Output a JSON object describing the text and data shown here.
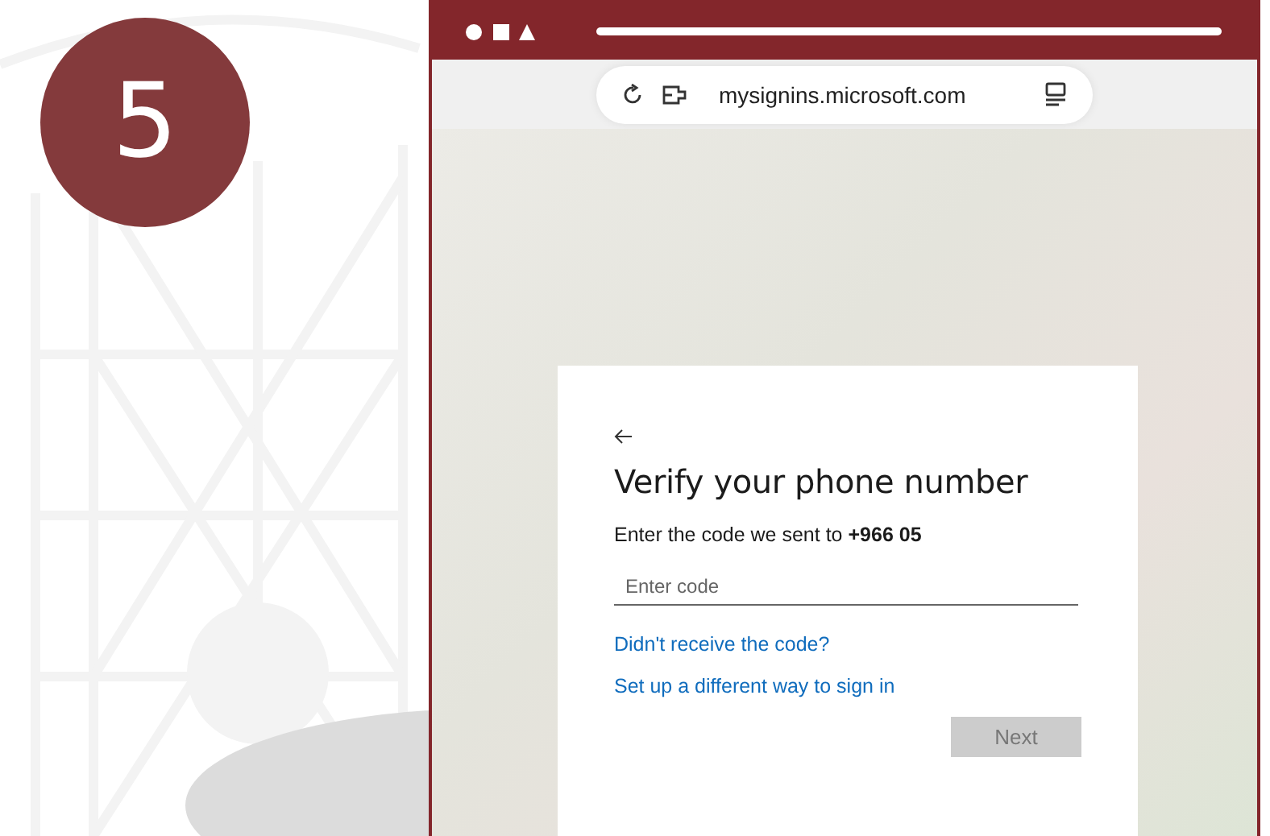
{
  "step_badge": "5",
  "browser": {
    "address": "mysignins.microsoft.com"
  },
  "card": {
    "title": "Verify your phone number",
    "instruction": "Enter the code we sent to **+966 05**",
    "code_field": {
      "placeholder": "Enter code"
    },
    "links": [
      "Didn't receive the code?",
      "Set up a different way to sign in"
    ],
    "next_button": {
      "label": "Next",
      "disabled": true
    }
  }
}
